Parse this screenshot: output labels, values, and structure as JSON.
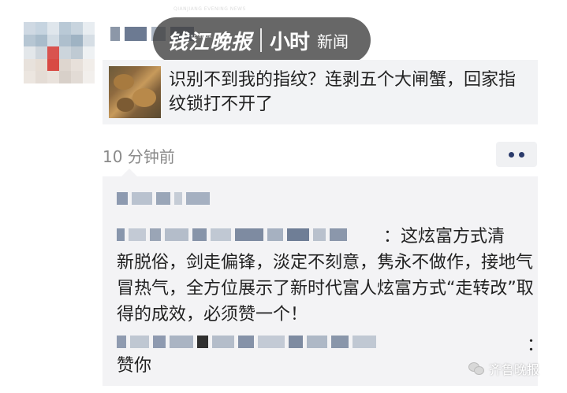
{
  "overlay_watermark": {
    "small_text": "QIANJIANG EVENING NEWS",
    "main_text": "钱江晚报",
    "hour_text": "小时",
    "news_text": "新闻",
    "sub_text": "THE HOUR"
  },
  "post": {
    "link_title": "识别不到我的指纹？连剥五个大闸蟹，回家指纹锁打不开了",
    "time": "10 分钟前"
  },
  "comment": {
    "text_line1": "：这炫富方式清",
    "text_rest": "新脱俗，剑走偏锋，淡定不刻意，隽永不做作，接地气冒热气，全方位展示了新时代富人炫富方式“走转改”取得的成效，必须赞一个！",
    "colon": "：",
    "reply_text": "赞你"
  },
  "corner_watermark": {
    "text": "齐鲁晚报"
  },
  "colors": {
    "card_bg": "#f2f3f5",
    "time_gray": "#8a8a8a",
    "more_dots": "#2b3b6b"
  }
}
